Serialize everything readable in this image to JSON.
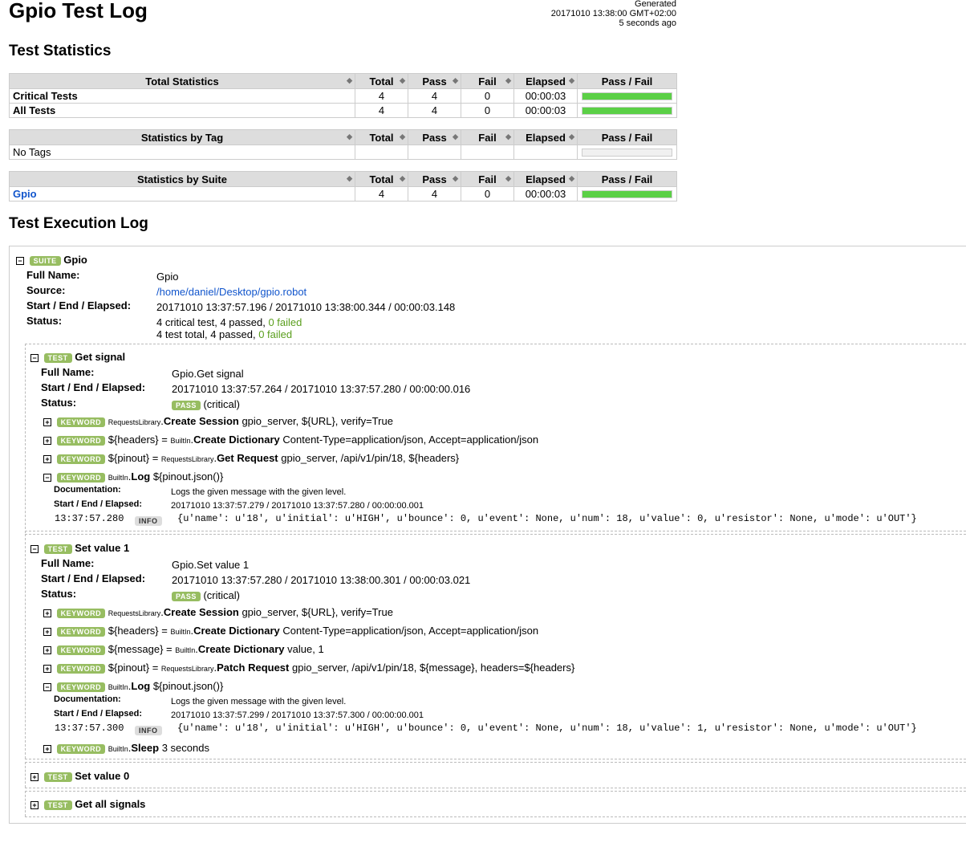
{
  "page": {
    "title": "Gpio Test Log",
    "generated_label": "Generated",
    "generated_time": "20171010 13:38:00 GMT+02:00",
    "generated_ago": "5 seconds ago",
    "stats_heading": "Test Statistics",
    "log_heading": "Test Execution Log"
  },
  "stats_columns": {
    "total": "Total",
    "pass": "Pass",
    "fail": "Fail",
    "elapsed": "Elapsed",
    "passfail": "Pass / Fail"
  },
  "total_stats": {
    "header": "Total Statistics",
    "rows": [
      {
        "name": "Critical Tests",
        "total": "4",
        "pass": "4",
        "fail": "0",
        "elapsed": "00:00:03",
        "pass_fraction": 1.0
      },
      {
        "name": "All Tests",
        "total": "4",
        "pass": "4",
        "fail": "0",
        "elapsed": "00:00:03",
        "pass_fraction": 1.0
      }
    ]
  },
  "tag_stats": {
    "header": "Statistics by Tag",
    "rows": [
      {
        "name": "No Tags"
      }
    ]
  },
  "suite_stats": {
    "header": "Statistics by Suite",
    "rows": [
      {
        "name": "Gpio",
        "total": "4",
        "pass": "4",
        "fail": "0",
        "elapsed": "00:00:03",
        "pass_fraction": 1.0
      }
    ]
  },
  "labels": {
    "suite": "SUITE",
    "test": "TEST",
    "keyword": "KEYWORD",
    "pass": "PASS",
    "info": "INFO",
    "full_name": "Full Name:",
    "source": "Source:",
    "start_end": "Start / End / Elapsed:",
    "status": "Status:",
    "documentation": "Documentation:",
    "critical": "(critical)"
  },
  "suite": {
    "name": "Gpio",
    "full_name": "Gpio",
    "source": "/home/daniel/Desktop/gpio.robot",
    "times": "20171010 13:37:57.196 / 20171010 13:38:00.344 / 00:00:03.148",
    "status_line1": "4 critical test, 4 passed, ",
    "status_line1_failed": "0 failed",
    "status_line2": "4 test total, 4 passed, ",
    "status_line2_failed": "0 failed"
  },
  "test1": {
    "name": "Get signal",
    "full_name": "Gpio.Get signal",
    "times": "20171010 13:37:57.264 / 20171010 13:37:57.280 / 00:00:00.016",
    "kw1": {
      "lib": "RequestsLibrary",
      "name": "Create Session",
      "args": " gpio_server, ${URL}, verify=True"
    },
    "kw2": {
      "assign": "${headers} = ",
      "lib": "BuiltIn",
      "name": "Create Dictionary",
      "args": " Content-Type=application/json, Accept=application/json"
    },
    "kw3": {
      "assign": "${pinout} = ",
      "lib": "RequestsLibrary",
      "name": "Get Request",
      "args": " gpio_server, /api/v1/pin/18, ${headers}"
    },
    "kw4": {
      "lib": "BuiltIn",
      "name": "Log",
      "args": " ${pinout.json()}",
      "doc": "Logs the given message with the given level.",
      "times": "20171010 13:37:57.279 / 20171010 13:37:57.280 / 00:00:00.001",
      "msg_time": "13:37:57.280",
      "msg": "{u'name': u'18', u'initial': u'HIGH', u'bounce': 0, u'event': None, u'num': 18, u'value': 0, u'resistor': None, u'mode': u'OUT'}"
    }
  },
  "test2": {
    "name": "Set value 1",
    "full_name": "Gpio.Set value 1",
    "times": "20171010 13:37:57.280 / 20171010 13:38:00.301 / 00:00:03.021",
    "kw1": {
      "lib": "RequestsLibrary",
      "name": "Create Session",
      "args": " gpio_server, ${URL}, verify=True"
    },
    "kw2": {
      "assign": "${headers} = ",
      "lib": "BuiltIn",
      "name": "Create Dictionary",
      "args": " Content-Type=application/json, Accept=application/json"
    },
    "kw3": {
      "assign": "${message} = ",
      "lib": "BuiltIn",
      "name": "Create Dictionary",
      "args": " value, 1"
    },
    "kw4": {
      "assign": "${pinout} = ",
      "lib": "RequestsLibrary",
      "name": "Patch Request",
      "args": " gpio_server, /api/v1/pin/18, ${message}, headers=${headers}"
    },
    "kw5": {
      "lib": "BuiltIn",
      "name": "Log",
      "args": " ${pinout.json()}",
      "doc": "Logs the given message with the given level.",
      "times": "20171010 13:37:57.299 / 20171010 13:37:57.300 / 00:00:00.001",
      "msg_time": "13:37:57.300",
      "msg": "{u'name': u'18', u'initial': u'HIGH', u'bounce': 0, u'event': None, u'num': 18, u'value': 1, u'resistor': None, u'mode': u'OUT'}"
    },
    "kw6": {
      "lib": "BuiltIn",
      "name": "Sleep",
      "args": " 3 seconds"
    }
  },
  "test3": {
    "name": "Set value 0"
  },
  "test4": {
    "name": "Get all signals"
  }
}
